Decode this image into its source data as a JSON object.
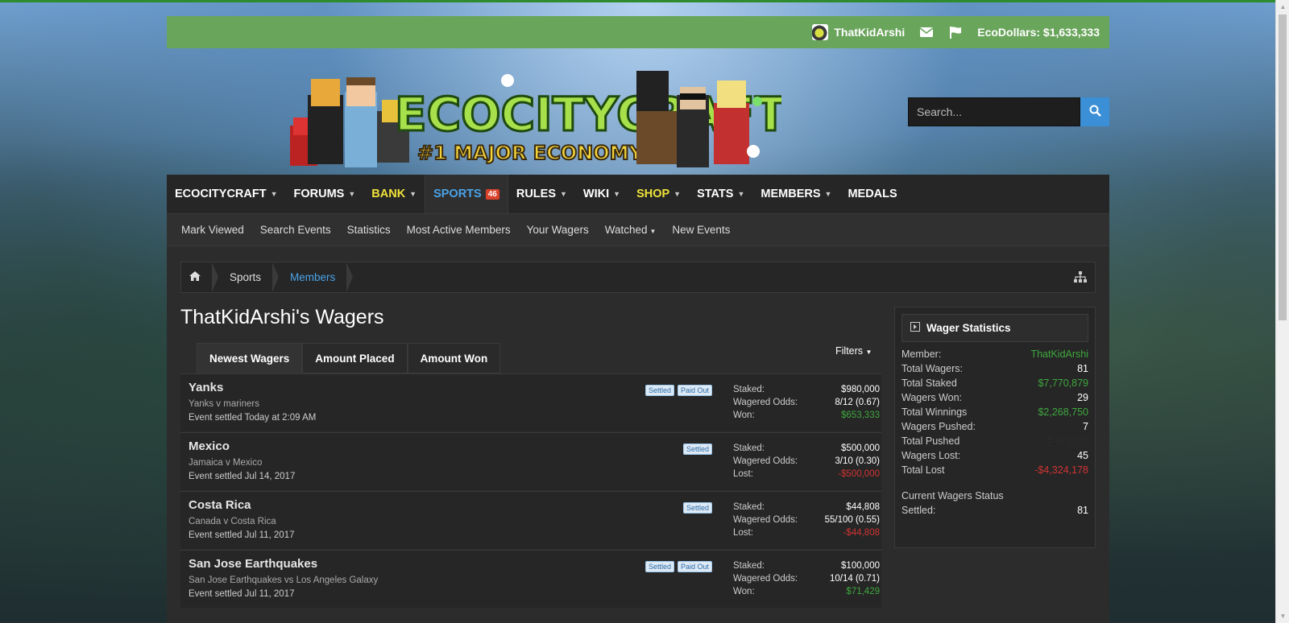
{
  "userbar": {
    "username": "ThatKidArshi",
    "balance": "EcoDollars: $1,633,333"
  },
  "logo": {
    "title": "ECOCITYCRAFT",
    "subtitle": "#1 MAJOR ECONOMY"
  },
  "search": {
    "placeholder": "Search..."
  },
  "nav": {
    "tabs": [
      {
        "label": "ECOCITYCRAFT",
        "caret": true
      },
      {
        "label": "FORUMS",
        "caret": true
      },
      {
        "label": "BANK",
        "caret": true,
        "highlight": "#f0e23a"
      },
      {
        "label": "SPORTS",
        "badge": "46",
        "active": true
      },
      {
        "label": "RULES",
        "caret": true
      },
      {
        "label": "WIKI",
        "caret": true
      },
      {
        "label": "SHOP",
        "caret": true,
        "highlight": "#f0e23a"
      },
      {
        "label": "STATS",
        "caret": true
      },
      {
        "label": "MEMBERS",
        "caret": true
      },
      {
        "label": "MEDALS"
      }
    ]
  },
  "subnav": {
    "items": [
      "Mark Viewed",
      "Search Events",
      "Statistics",
      "Most Active Members",
      "Your Wagers",
      "Watched",
      "New Events"
    ]
  },
  "breadcrumb": {
    "items": [
      "Sports",
      "Members"
    ]
  },
  "page": {
    "title": "ThatKidArshi's Wagers"
  },
  "tabs": {
    "items": [
      "Newest Wagers",
      "Amount Placed",
      "Amount Won"
    ],
    "filters": "Filters"
  },
  "labels": {
    "staked": "Staked:",
    "odds": "Wagered Odds:",
    "won": "Won:",
    "lost": "Lost:",
    "settled": "Settled",
    "paid_out": "Paid Out"
  },
  "wagers": [
    {
      "title": "Yanks",
      "desc": "Yanks v mariners",
      "settled_at": "Event settled Today at 2:09 AM",
      "paid_out": true,
      "staked": "$980,000",
      "odds": "8/12 (0.67)",
      "result_label": "Won:",
      "result": "$653,333",
      "result_color": "#3ea83e"
    },
    {
      "title": "Mexico",
      "desc": "Jamaica v Mexico",
      "settled_at": "Event settled Jul 14, 2017",
      "paid_out": false,
      "staked": "$500,000",
      "odds": "3/10 (0.30)",
      "result_label": "Lost:",
      "result": "-$500,000",
      "result_color": "#d23333"
    },
    {
      "title": "Costa Rica",
      "desc": "Canada v Costa Rica",
      "settled_at": "Event settled Jul 11, 2017",
      "paid_out": false,
      "staked": "$44,808",
      "odds": "55/100 (0.55)",
      "result_label": "Lost:",
      "result": "-$44,808",
      "result_color": "#d23333"
    },
    {
      "title": "San Jose Earthquakes",
      "desc": "San Jose Earthquakes vs Los Angeles Galaxy",
      "settled_at": "Event settled Jul 11, 2017",
      "paid_out": true,
      "staked": "$100,000",
      "odds": "10/14 (0.71)",
      "result_label": "Won:",
      "result": "$71,429",
      "result_color": "#3ea83e"
    }
  ],
  "sidebar": {
    "title": "Wager Statistics",
    "rows": [
      {
        "k": "Member:",
        "v": "ThatKidArshi",
        "color": "#3ea83e"
      },
      {
        "k": "Total Wagers:",
        "v": "81"
      },
      {
        "k": "Total Staked",
        "v": "$7,770,879",
        "color": "#3ea83e"
      },
      {
        "k": "Wagers Won:",
        "v": "29"
      },
      {
        "k": "Total Winnings",
        "v": "$2,268,750",
        "color": "#3ea83e"
      },
      {
        "k": "Wagers Pushed:",
        "v": "7"
      },
      {
        "k": "Total Pushed",
        "v": "$106,000",
        "color": "#1a1a1a"
      },
      {
        "k": "Wagers Lost:",
        "v": "45"
      },
      {
        "k": "Total Lost",
        "v": "-$4,324,178",
        "color": "#d23333"
      }
    ],
    "status_title": "Current Wagers Status",
    "status_rows": [
      {
        "k": "Settled:",
        "v": "81"
      }
    ]
  }
}
